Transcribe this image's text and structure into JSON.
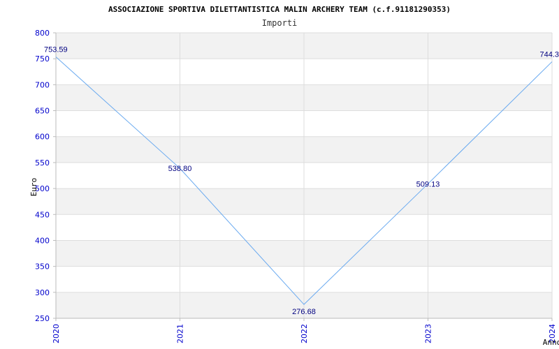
{
  "title": "ASSOCIAZIONE SPORTIVA DILETTANTISTICA MALIN ARCHERY TEAM (c.f.91181290353)",
  "subtitle": "Importi",
  "chart_data": {
    "type": "line",
    "x": [
      "2020",
      "2021",
      "2022",
      "2023",
      "2024"
    ],
    "series": [
      {
        "values": [
          753.59,
          538.8,
          276.68,
          509.13,
          744.3
        ],
        "labels": [
          "753.59",
          "538.80",
          "276.68",
          "509.13",
          "744.3"
        ]
      }
    ],
    "xlabel": "Anno",
    "ylabel": "Euro",
    "ylim": [
      250,
      800
    ],
    "yticks": [
      250,
      300,
      350,
      400,
      450,
      500,
      550,
      600,
      650,
      700,
      750,
      800
    ],
    "grid": true,
    "band_colors": [
      "#ffffff",
      "#f2f2f2"
    ],
    "line_color": "#6aaaf0",
    "tick_color": "#0000cc",
    "label_color": "#000080"
  }
}
